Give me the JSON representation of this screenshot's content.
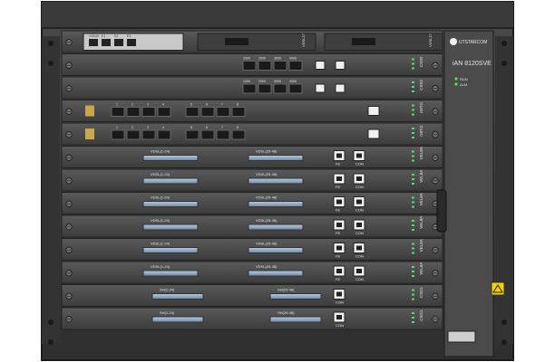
{
  "brand": {
    "logo_text": "UTSTARCOM",
    "model": "iAN 8120SVE",
    "status_leds": [
      "RUN",
      "ALM"
    ]
  },
  "slots": [
    {
      "type": "uplink-4port",
      "ports": [
        "10/100",
        "E1",
        "E2",
        "E3"
      ],
      "side": "PCI14",
      "extra_cards": [
        "VDSL17",
        "VDSL17"
      ]
    },
    {
      "type": "sfp-4",
      "ports": [
        "1000",
        "2000",
        "3000",
        "4000"
      ],
      "side": "CSS2"
    },
    {
      "type": "sfp-4",
      "ports": [
        "1000",
        "2000",
        "3000",
        "4000"
      ],
      "side": "CSS2"
    },
    {
      "type": "sfp-8",
      "ports": [
        "1",
        "2",
        "3",
        "4",
        "5",
        "6",
        "7",
        "8"
      ],
      "side": "G8TG"
    },
    {
      "type": "sfp-8",
      "ports": [
        "1",
        "2",
        "3",
        "4",
        "5",
        "6",
        "7",
        "8"
      ],
      "side": "G8TG"
    },
    {
      "type": "vdsl",
      "connectors": [
        "VDSL(1-24)",
        "VDSL(25-48)"
      ],
      "rj45": [
        "FE",
        "CON"
      ],
      "side": "VEL8A"
    },
    {
      "type": "vdsl",
      "connectors": [
        "VDSL(1-24)",
        "VDSL(25-48)"
      ],
      "rj45": [
        "FE",
        "CON"
      ],
      "side": "VEL8A"
    },
    {
      "type": "vdsl",
      "connectors": [
        "VDSL(1-24)",
        "VDSL(25-48)"
      ],
      "rj45": [
        "FE",
        "CON"
      ],
      "side": "VEL8A"
    },
    {
      "type": "vdsl",
      "connectors": [
        "VDSL(1-24)",
        "VDSL(25-48)"
      ],
      "rj45": [
        "FE",
        "CON"
      ],
      "side": "VEL8A"
    },
    {
      "type": "vdsl",
      "connectors": [
        "VDSL(1-24)",
        "VDSL(25-48)"
      ],
      "rj45": [
        "FE",
        "CON"
      ],
      "side": "VEL8A"
    },
    {
      "type": "vdsl",
      "connectors": [
        "VDSL(1-24)",
        "VDSL(25-48)"
      ],
      "rj45": [
        "FE",
        "CON"
      ],
      "side": "VEL8A"
    },
    {
      "type": "shdsl",
      "connectors": [
        "SH(1-24)",
        "SH(25-48)"
      ],
      "rj45": [
        "CON"
      ],
      "side": "CSG1"
    },
    {
      "type": "shdsl",
      "connectors": [
        "SH(1-24)",
        "SH(25-48)"
      ],
      "rj45": [
        "CON"
      ],
      "side": "CSG1"
    }
  ],
  "colors": {
    "frame": "#3a3a3a",
    "card": "#4a4a4a",
    "card_edge": "#222222",
    "connector": "#8fa9c4",
    "sfp": "#1a1a1a",
    "led_green": "#4fe06a",
    "warning": "#f3d400"
  }
}
